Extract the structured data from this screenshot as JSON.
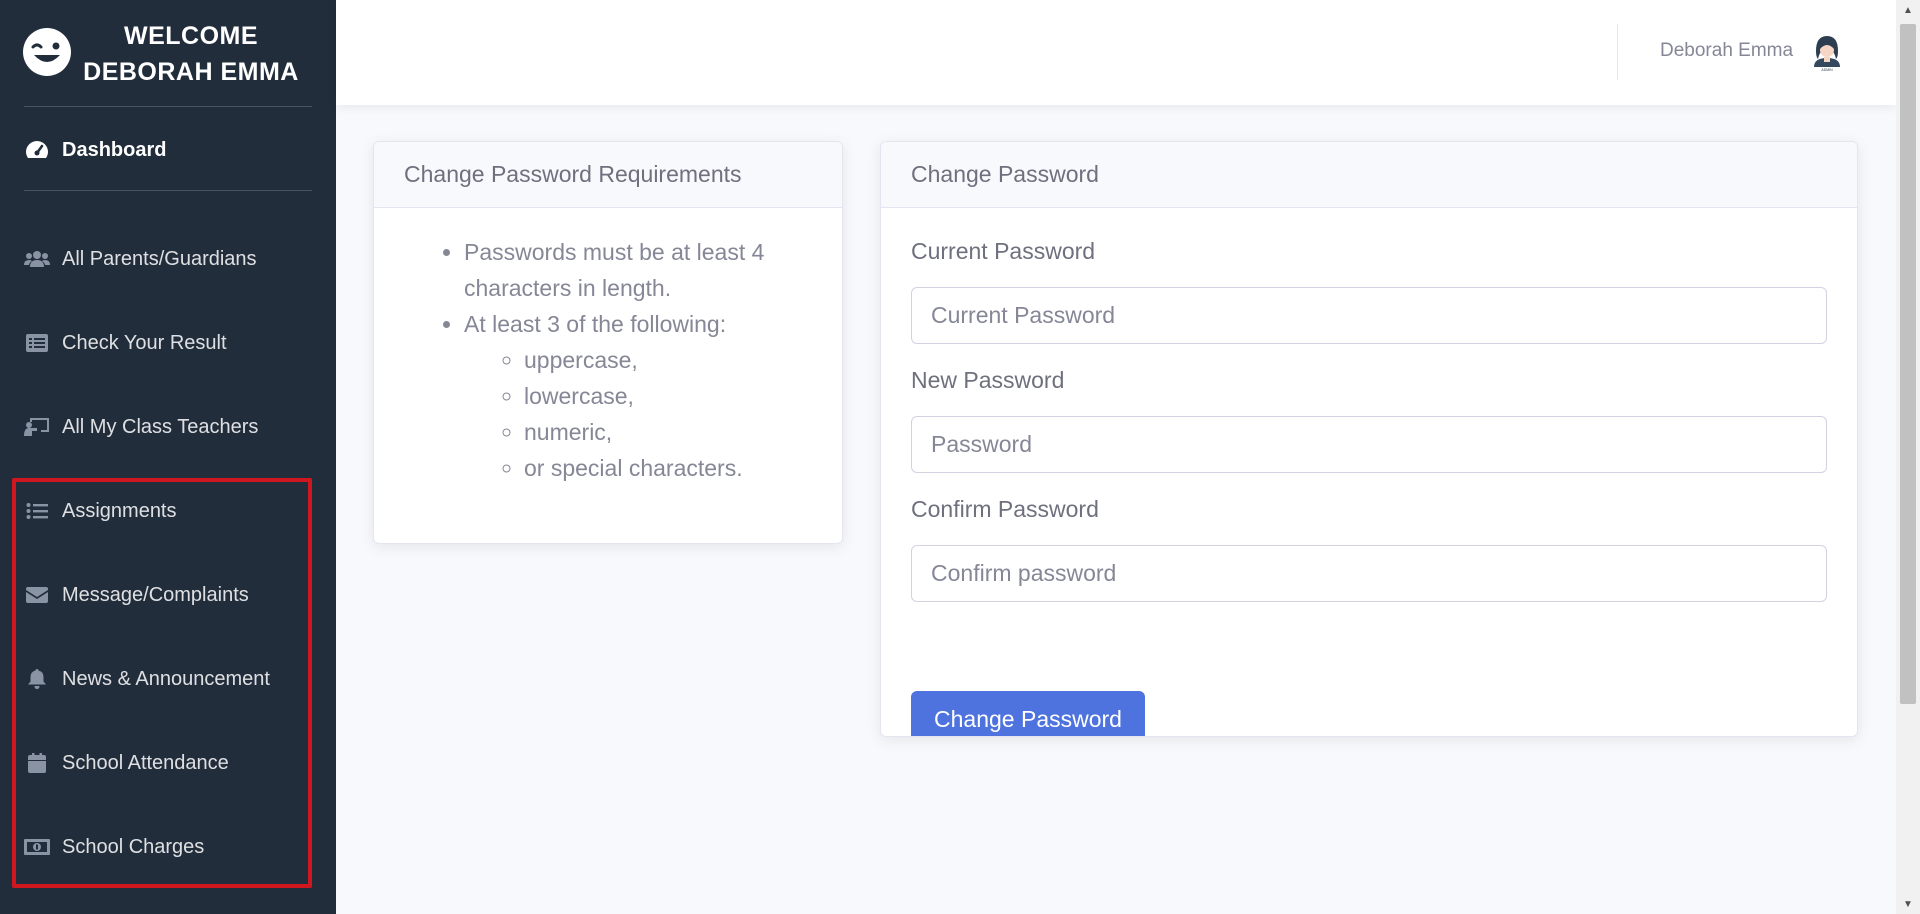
{
  "sidebar": {
    "brand_text": "WELCOME DEBORAH EMMA",
    "brand_icon": "wink-face-icon",
    "dashboard": {
      "label": "Dashboard",
      "icon": "tachometer-icon"
    },
    "items": [
      {
        "label": "All Parents/Guardians",
        "icon": "users-icon"
      },
      {
        "label": "Check Your Result",
        "icon": "list-alt-icon"
      },
      {
        "label": "All My Class Teachers",
        "icon": "chalkboard-teacher-icon"
      },
      {
        "label": "Assignments",
        "icon": "list-ul-icon"
      },
      {
        "label": "Message/Complaints",
        "icon": "envelope-icon"
      },
      {
        "label": "News & Announcement",
        "icon": "bell-icon"
      },
      {
        "label": "School Attendance",
        "icon": "calendar-icon"
      },
      {
        "label": "School Charges",
        "icon": "money-bill-icon"
      }
    ]
  },
  "topbar": {
    "user_name": "Deborah Emma",
    "avatar_icon": "admin-avatar-icon"
  },
  "requirements_card": {
    "title": "Change Password Requirements",
    "items": [
      "Passwords must be at least 4 characters in length.",
      "At least 3 of the following:"
    ],
    "subitems": [
      "uppercase,",
      "lowercase,",
      "numeric,",
      "or special characters."
    ]
  },
  "password_card": {
    "title": "Change Password",
    "current_label": "Current Password",
    "current_placeholder": "Current Password",
    "new_label": "New Password",
    "new_placeholder": "Password",
    "confirm_label": "Confirm Password",
    "confirm_placeholder": "Confirm password",
    "submit_label": "Change Password"
  },
  "colors": {
    "sidebar_bg": "#222d3c",
    "primary": "#4e73df",
    "highlight": "#d0161f"
  }
}
